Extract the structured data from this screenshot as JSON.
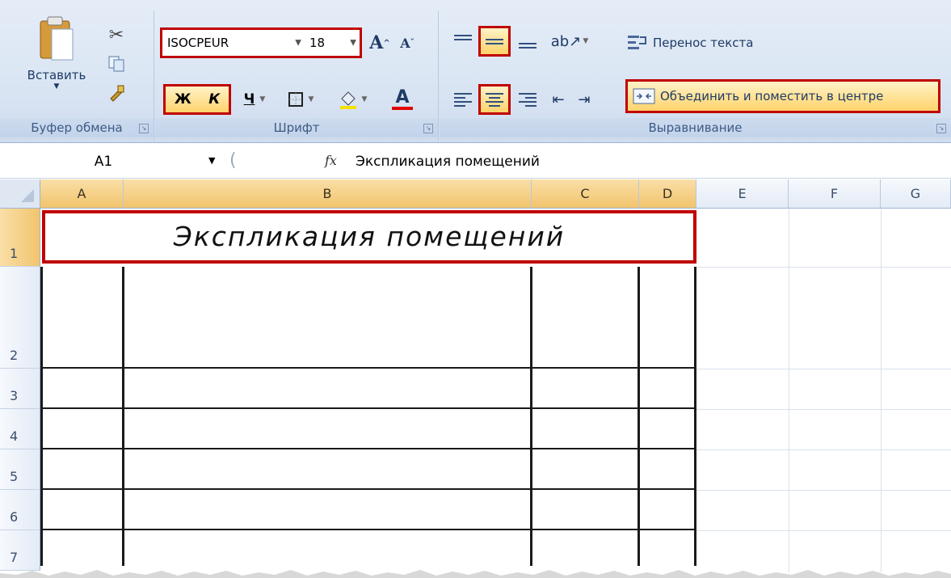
{
  "ribbon": {
    "clipboard": {
      "paste_label": "Вставить",
      "group_label": "Буфер обмена"
    },
    "font": {
      "font_name": "ISOCPEUR",
      "font_size": "18",
      "grow_label": "A",
      "shrink_label": "A",
      "bold_label": "Ж",
      "italic_label": "К",
      "underline_label": "Ч",
      "font_color_label": "A",
      "group_label": "Шрифт"
    },
    "alignment": {
      "wrap_text_label": "Перенос текста",
      "merge_center_label": "Объединить и поместить в центре",
      "group_label": "Выравнивание"
    }
  },
  "formula_bar": {
    "name_box": "A1",
    "fx_label": "fx",
    "formula": "Экспликация помещений"
  },
  "sheet": {
    "columns": [
      "A",
      "B",
      "C",
      "D",
      "E",
      "F",
      "G"
    ],
    "rows": [
      "1",
      "2",
      "3",
      "4",
      "5",
      "6",
      "7"
    ],
    "merged_cell_text": "Экспликация помещений"
  },
  "colors": {
    "highlight": "#c00000",
    "ribbon_bg": "#dbe6f4",
    "selected_header": "#f2c46d"
  }
}
